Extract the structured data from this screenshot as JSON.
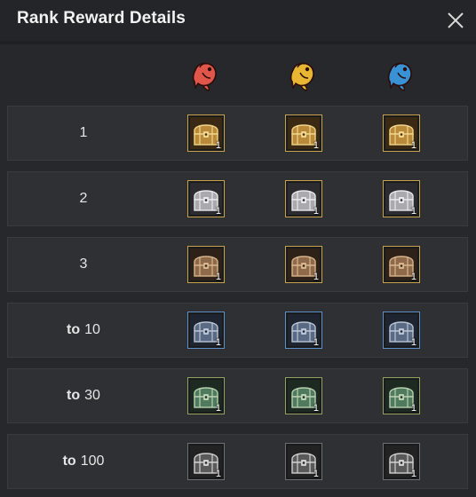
{
  "dialog": {
    "title": "Rank Reward Details",
    "close_icon": "close-x-icon"
  },
  "columns": [
    {
      "icon": "red-fish-icon",
      "color": "#e0564a"
    },
    {
      "icon": "gold-fish-icon",
      "color": "#e9b634"
    },
    {
      "icon": "blue-fish-icon",
      "color": "#3a92d6"
    }
  ],
  "rows": [
    {
      "prefix": "",
      "rank": "1",
      "tier": "gold",
      "quantities": [
        "1",
        "1",
        "1"
      ]
    },
    {
      "prefix": "",
      "rank": "2",
      "tier": "silver",
      "quantities": [
        "1",
        "1",
        "1"
      ]
    },
    {
      "prefix": "",
      "rank": "3",
      "tier": "bronze",
      "quantities": [
        "1",
        "1",
        "1"
      ]
    },
    {
      "prefix": "to",
      "rank": "10",
      "tier": "blue",
      "quantities": [
        "1",
        "1",
        "1"
      ]
    },
    {
      "prefix": "to",
      "rank": "30",
      "tier": "green",
      "quantities": [
        "1",
        "1",
        "1"
      ]
    },
    {
      "prefix": "to",
      "rank": "100",
      "tier": "gray",
      "quantities": [
        "1",
        "1",
        "1"
      ]
    }
  ],
  "tier_colors": {
    "gold": {
      "frame": "#c9a24c",
      "chest": "#b98a3a",
      "trim": "#f1d58a",
      "inner": "#3a2a14"
    },
    "silver": {
      "frame": "#c9a24c",
      "chest": "#a9a9ae",
      "trim": "#e8e8ec",
      "inner": "#2c2c30"
    },
    "bronze": {
      "frame": "#c9a24c",
      "chest": "#8f6a4a",
      "trim": "#d6b48c",
      "inner": "#2e2218"
    },
    "blue": {
      "frame": "#5d8fc8",
      "chest": "#5a6a84",
      "trim": "#b8c4d4",
      "inner": "#1e2430"
    },
    "green": {
      "frame": "#8fa25e",
      "chest": "#4f7a5e",
      "trim": "#b8d0b0",
      "inner": "#1d2a22"
    },
    "gray": {
      "frame": "#6e6f72",
      "chest": "#5b5a5a",
      "trim": "#cfcfcf",
      "inner": "#222222"
    }
  }
}
